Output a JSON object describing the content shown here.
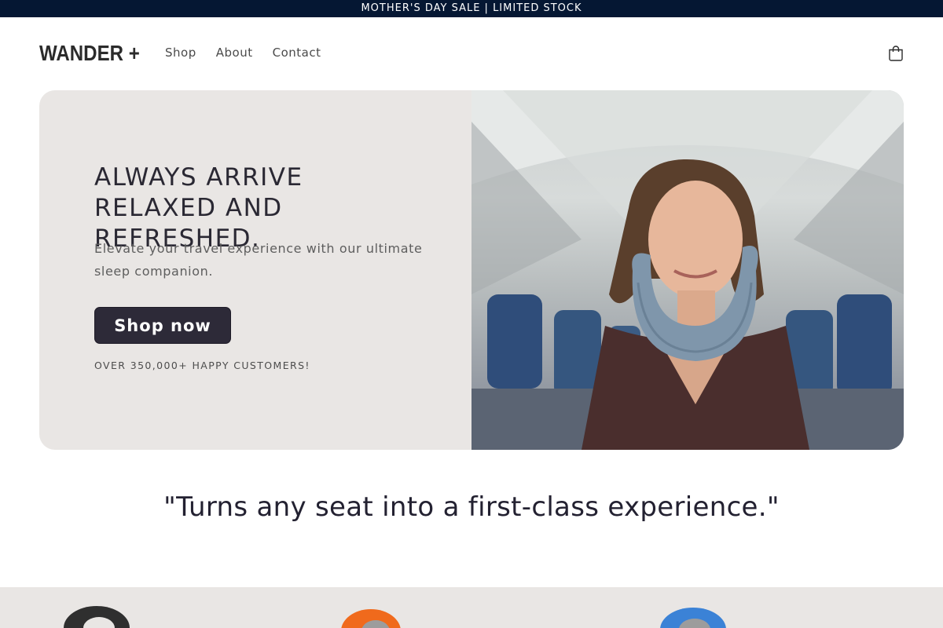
{
  "announcement": {
    "text": "MOTHER'S DAY SALE | LIMITED STOCK"
  },
  "header": {
    "logo": "WANDER +",
    "nav": [
      {
        "label": "Shop"
      },
      {
        "label": "About"
      },
      {
        "label": "Contact"
      }
    ],
    "cart_icon": "cart-icon"
  },
  "hero": {
    "title": "ALWAYS ARRIVE RELAXED AND REFRESHED.",
    "subtitle": "Elevate your travel experience with our ultimate sleep companion.",
    "button_label": "Shop now",
    "note": "OVER 350,000+ HAPPY CUSTOMERS!"
  },
  "quote": "\"Turns any seat into a first-class experience.\"",
  "products": [
    {
      "color": "#2f2f2f"
    },
    {
      "color": "#f06a1c"
    },
    {
      "color": "#3b82d6"
    }
  ],
  "colors": {
    "announcement_bg": "#051733",
    "hero_bg": "#e9e6e4",
    "button_bg": "#2d2a38",
    "text_dark": "#2a2833"
  }
}
